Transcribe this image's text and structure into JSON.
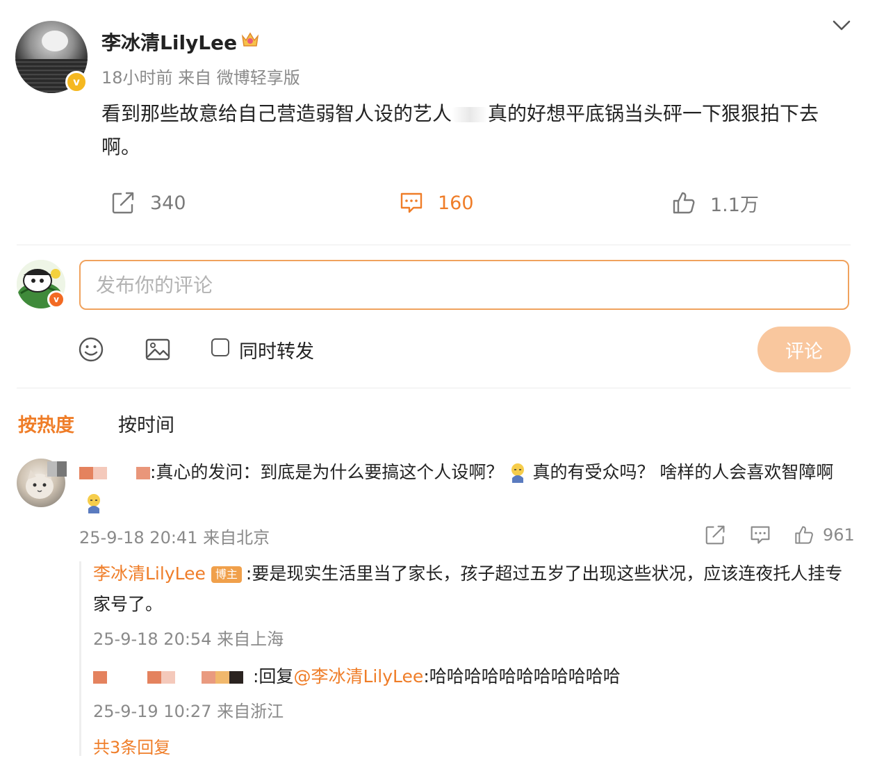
{
  "post": {
    "author": "李冰清LilyLee",
    "meta": "18小时前  来自 微博轻享版",
    "text_before": "看到那些故意给自己营造弱智人设的艺人",
    "text_after": "真的好想平底锅当头砰一下狠狠拍下去啊。",
    "reposts": "340",
    "comments": "160",
    "likes": "1.1万"
  },
  "composer": {
    "placeholder": "发布你的评论",
    "repost_label": "同时转发",
    "submit_label": "评论"
  },
  "tabs": {
    "hot": "按热度",
    "time": "按时间"
  },
  "comment": {
    "text_part1": ":真心的发问：到底是为什么要搞这个人设啊？",
    "text_part2": "真的有受众吗？  啥样的人会喜欢智障啊",
    "meta": "25-9-18 20:41 来自北京",
    "likes": "961"
  },
  "replies": [
    {
      "author": "李冰清LilyLee",
      "badge": "博主",
      "text": ":要是现实生活里当了家长，孩子超过五岁了出现这些状况，应该连夜托人挂专家号了。",
      "meta": "25-9-18 20:54 来自上海"
    },
    {
      "prefix": ":回复",
      "mention": "@李冰清LilyLee",
      "text": ":哈哈哈哈哈哈哈哈哈哈哈",
      "meta": "25-9-19 10:27 来自浙江"
    }
  ],
  "more_replies": "共3条回复",
  "colors": {
    "accent": "#ef7d28",
    "input_border": "#f0a25d",
    "submit_bg": "#f9c79e",
    "verified_gold": "#f5b820"
  },
  "icons": [
    "chevron-down-icon",
    "crown-icon",
    "repost-icon",
    "comment-icon",
    "like-icon",
    "emoji-icon",
    "image-icon",
    "verified-icon"
  ]
}
